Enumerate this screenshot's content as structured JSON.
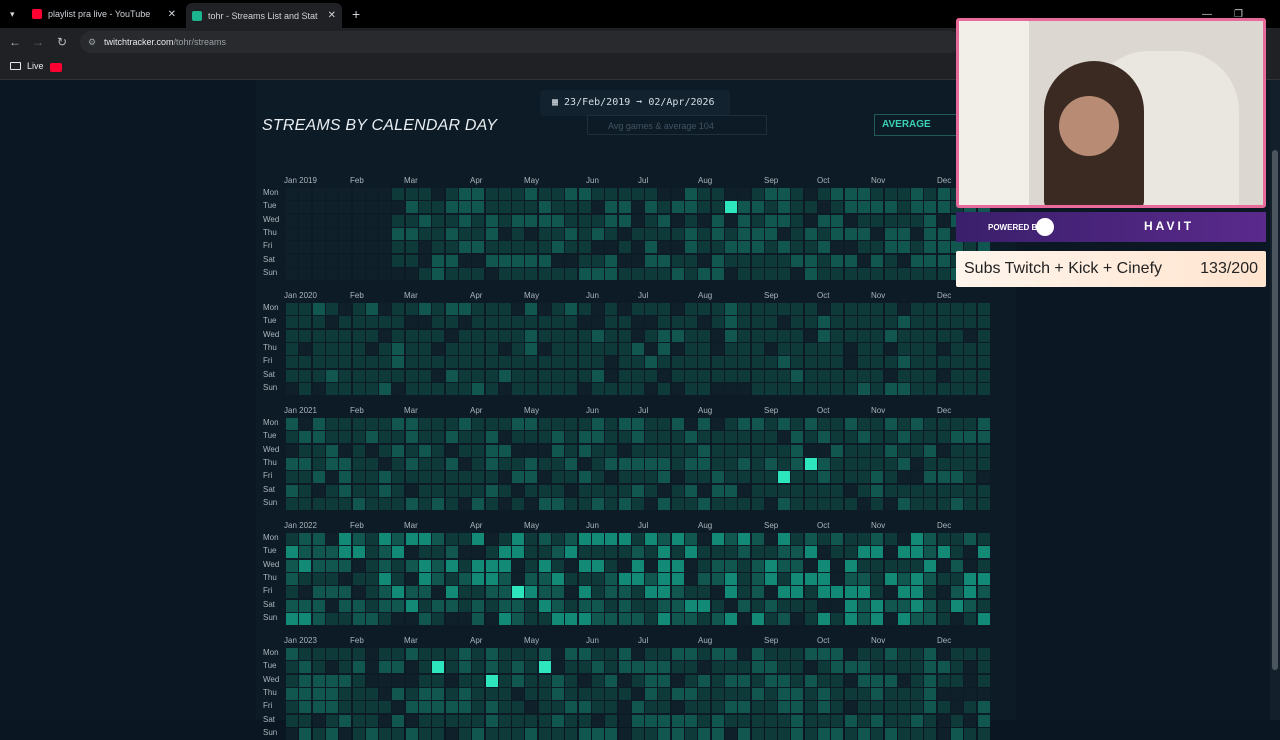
{
  "browser": {
    "tabs": [
      {
        "label": "playlist pra live - YouTube",
        "icon": "youtube-icon"
      },
      {
        "label": "tohr - Streams List and Statistic",
        "icon": "twitchtracker-icon"
      }
    ],
    "url_domain": "twitchtracker.com",
    "url_path": "/tohr/streams",
    "bookmarks": [
      {
        "label": "Live"
      }
    ]
  },
  "page": {
    "title": "STREAMS BY CALENDAR DAY",
    "date_range": "23/Feb/2019 ➞ 02/Apr/2026",
    "legend_text": "Avg games & average 104",
    "average_viewers_button": "AVERAGE VIEWERS"
  },
  "calendar": {
    "days": [
      "Mon",
      "Tue",
      "Wed",
      "Thu",
      "Fri",
      "Sat",
      "Sun"
    ],
    "years": [
      {
        "year": "Jan 2019",
        "months": [
          "Feb",
          "Mar",
          "Apr",
          "May",
          "Jun",
          "Jul",
          "Aug",
          "Sep",
          "Oct",
          "Nov",
          "Dec"
        ]
      },
      {
        "year": "Jan 2020",
        "months": [
          "Feb",
          "Mar",
          "Apr",
          "May",
          "Jun",
          "Jul",
          "Aug",
          "Sep",
          "Oct",
          "Nov",
          "Dec"
        ]
      },
      {
        "year": "Jan 2021",
        "months": [
          "Feb",
          "Mar",
          "Apr",
          "May",
          "Jun",
          "Jul",
          "Aug",
          "Sep",
          "Oct",
          "Nov",
          "Dec"
        ]
      },
      {
        "year": "Jan 2022",
        "months": [
          "Feb",
          "Mar",
          "Apr",
          "May",
          "Jun",
          "Jul",
          "Aug",
          "Sep",
          "Oct",
          "Nov",
          "Dec"
        ]
      },
      {
        "year": "Jan 2023",
        "months": [
          "Feb",
          "Mar",
          "Apr",
          "May",
          "Jun",
          "Jul",
          "Aug",
          "Sep",
          "Oct",
          "Nov",
          "Dec"
        ]
      }
    ],
    "colors": {
      "empty": "#10202b",
      "low": "#0f3a3a",
      "mid": "#11564f",
      "high": "#138a76",
      "max": "#2ee6bd"
    }
  },
  "overlay": {
    "sponsor_powered": "POWERED BY",
    "sponsor_brand": "HAVIT",
    "subs_label": "Subs Twitch + Kick + Cinefy",
    "subs_count": "133/200"
  }
}
